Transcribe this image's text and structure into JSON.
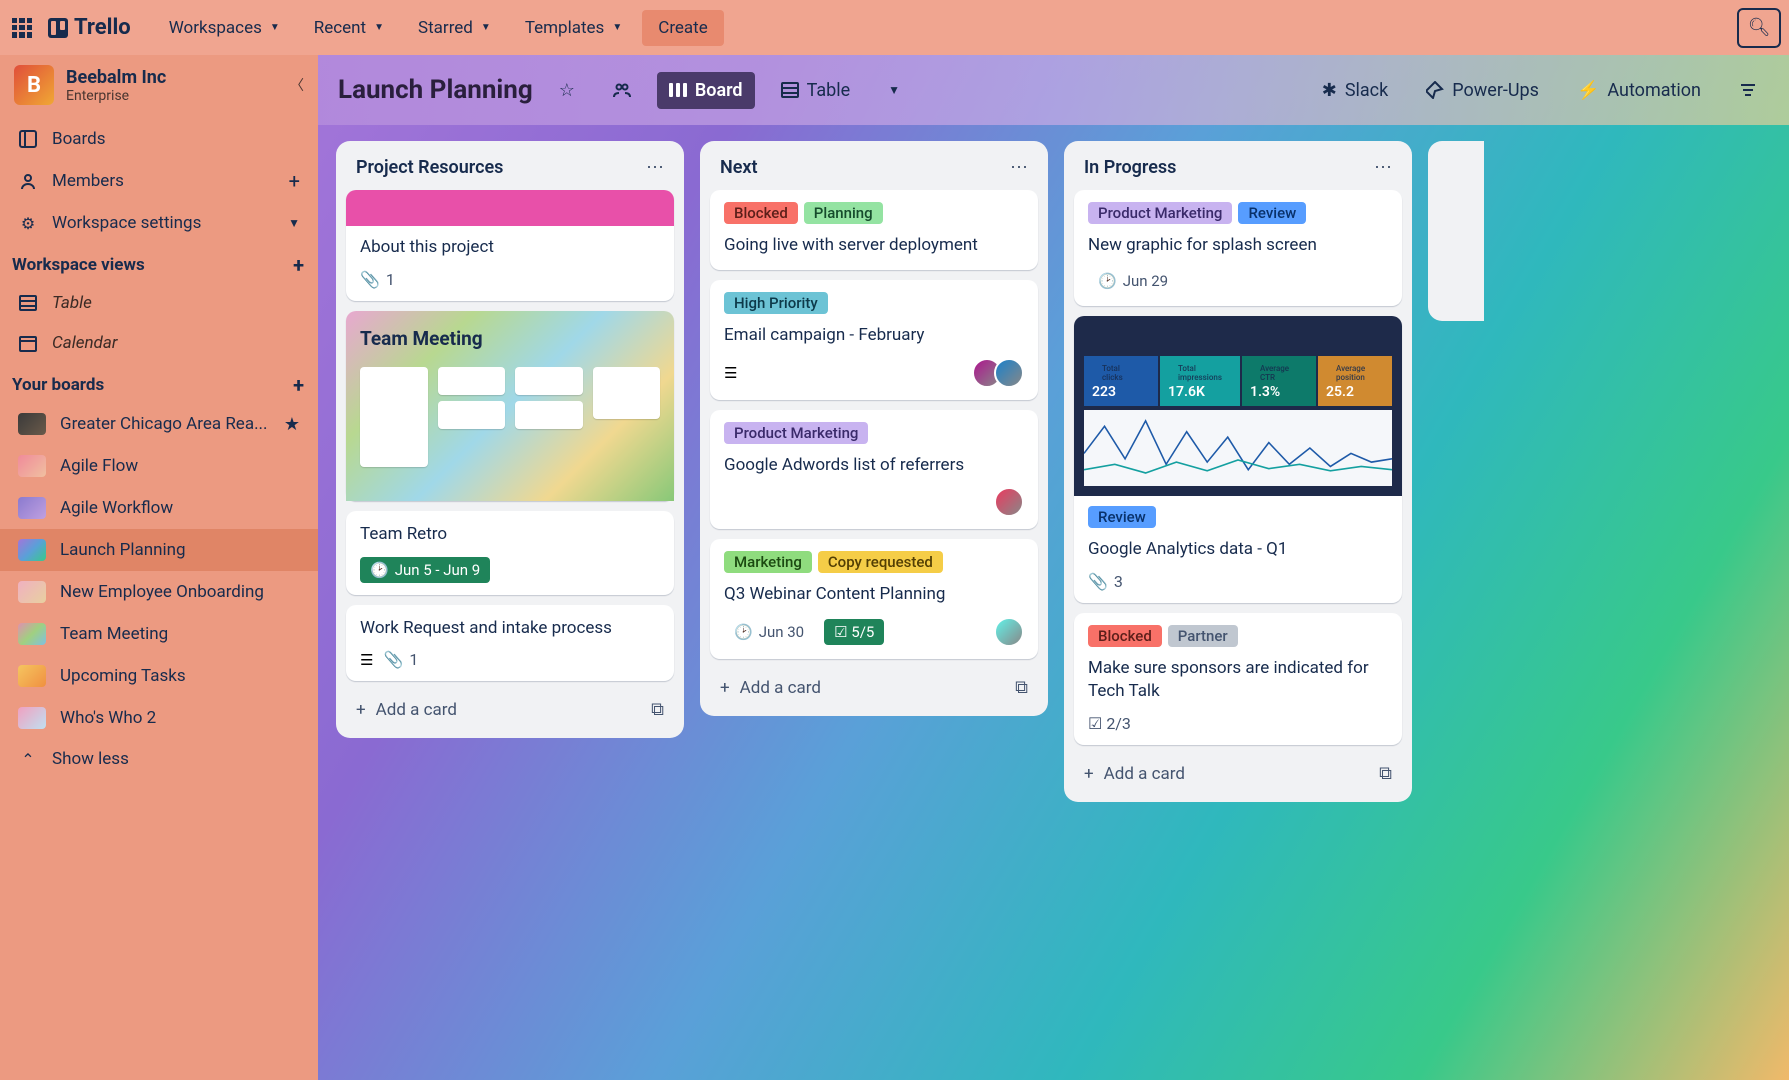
{
  "app_name": "Trello",
  "topnav": {
    "items": [
      "Workspaces",
      "Recent",
      "Starred",
      "Templates"
    ],
    "create": "Create"
  },
  "workspace": {
    "initial": "B",
    "name": "Beebalm Inc",
    "plan": "Enterprise"
  },
  "sidebar": {
    "boards": "Boards",
    "members": "Members",
    "settings": "Workspace settings",
    "views_heading": "Workspace views",
    "views": [
      "Table",
      "Calendar"
    ],
    "your_boards_heading": "Your boards",
    "boards_list": [
      {
        "name": "Greater Chicago Area Rea...",
        "starred": true,
        "thumb": "linear-gradient(135deg,#3a3a3a,#6a5a4a)"
      },
      {
        "name": "Agile Flow",
        "thumb": "linear-gradient(135deg,#f08a9a,#f0c0a0)"
      },
      {
        "name": "Agile Workflow",
        "thumb": "linear-gradient(135deg,#8a7acf,#c0a0e0)"
      },
      {
        "name": "Launch Planning",
        "active": true,
        "thumb": "linear-gradient(135deg,#a375d9,#5aa0d8,#38c98a)"
      },
      {
        "name": "New Employee Onboarding",
        "thumb": "linear-gradient(135deg,#f0b0c0,#e8d0a0)"
      },
      {
        "name": "Team Meeting",
        "thumb": "linear-gradient(135deg,#e090b0,#a0d080,#80c0e0)"
      },
      {
        "name": "Upcoming Tasks",
        "thumb": "linear-gradient(135deg,#f5c560,#f09040)"
      },
      {
        "name": "Who's Who 2",
        "thumb": "linear-gradient(135deg,#f0a0c0,#c0e0f0)"
      }
    ],
    "show_less": "Show less"
  },
  "board_header": {
    "name": "Launch Planning",
    "board_view": "Board",
    "table_view": "Table",
    "slack": "Slack",
    "powerups": "Power-Ups",
    "automation": "Automation"
  },
  "lists": [
    {
      "title": "Project Resources",
      "cards": [
        {
          "cover": "pink",
          "title": "About this project",
          "attachments": "1"
        },
        {
          "cover": "team-meeting",
          "cover_title": "Team Meeting"
        },
        {
          "title": "Team Retro",
          "date": "Jun 5 - Jun 9",
          "date_done": true
        },
        {
          "title": "Work Request and intake process",
          "desc": true,
          "attachments": "1"
        }
      ],
      "add": "Add a card"
    },
    {
      "title": "Next",
      "cards": [
        {
          "labels": [
            {
              "t": "Blocked",
              "c": "l-red"
            },
            {
              "t": "Planning",
              "c": "l-green"
            }
          ],
          "title": "Going live with server deployment"
        },
        {
          "labels": [
            {
              "t": "High Priority",
              "c": "l-teal"
            }
          ],
          "title": "Email campaign - February",
          "desc": true,
          "members": 2
        },
        {
          "labels": [
            {
              "t": "Product Marketing",
              "c": "l-purple"
            }
          ],
          "title": "Google Adwords list of referrers",
          "members": 1
        },
        {
          "labels": [
            {
              "t": "Marketing",
              "c": "l-lime"
            },
            {
              "t": "Copy requested",
              "c": "l-yellow"
            }
          ],
          "title": "Q3 Webinar Content Planning",
          "date": "Jun 30",
          "check": "5/5",
          "members": 1
        }
      ],
      "add": "Add a card"
    },
    {
      "title": "In Progress",
      "cards": [
        {
          "labels": [
            {
              "t": "Product Marketing",
              "c": "l-purple"
            },
            {
              "t": "Review",
              "c": "l-blue"
            }
          ],
          "title": "New graphic for splash screen",
          "date": "Jun 29"
        },
        {
          "cover": "chart",
          "labels": [
            {
              "t": "Review",
              "c": "l-blue"
            }
          ],
          "title": "Google Analytics data - Q1",
          "attachments": "3",
          "chart_kpis": [
            {
              "label": "Total clicks",
              "val": "223",
              "bg": "#1e5aa8"
            },
            {
              "label": "Total impressions",
              "val": "17.6K",
              "bg": "#14a0a0"
            },
            {
              "label": "Average CTR",
              "val": "1.3%",
              "bg": "#0d7a6a"
            },
            {
              "label": "Average position",
              "val": "25.2",
              "bg": "#d08a30"
            }
          ]
        },
        {
          "labels": [
            {
              "t": "Blocked",
              "c": "l-red"
            },
            {
              "t": "Partner",
              "c": "l-gray"
            }
          ],
          "title": "Make sure sponsors are indicated for Tech Talk",
          "check_plain": "2/3"
        }
      ],
      "add": "Add a card"
    }
  ]
}
